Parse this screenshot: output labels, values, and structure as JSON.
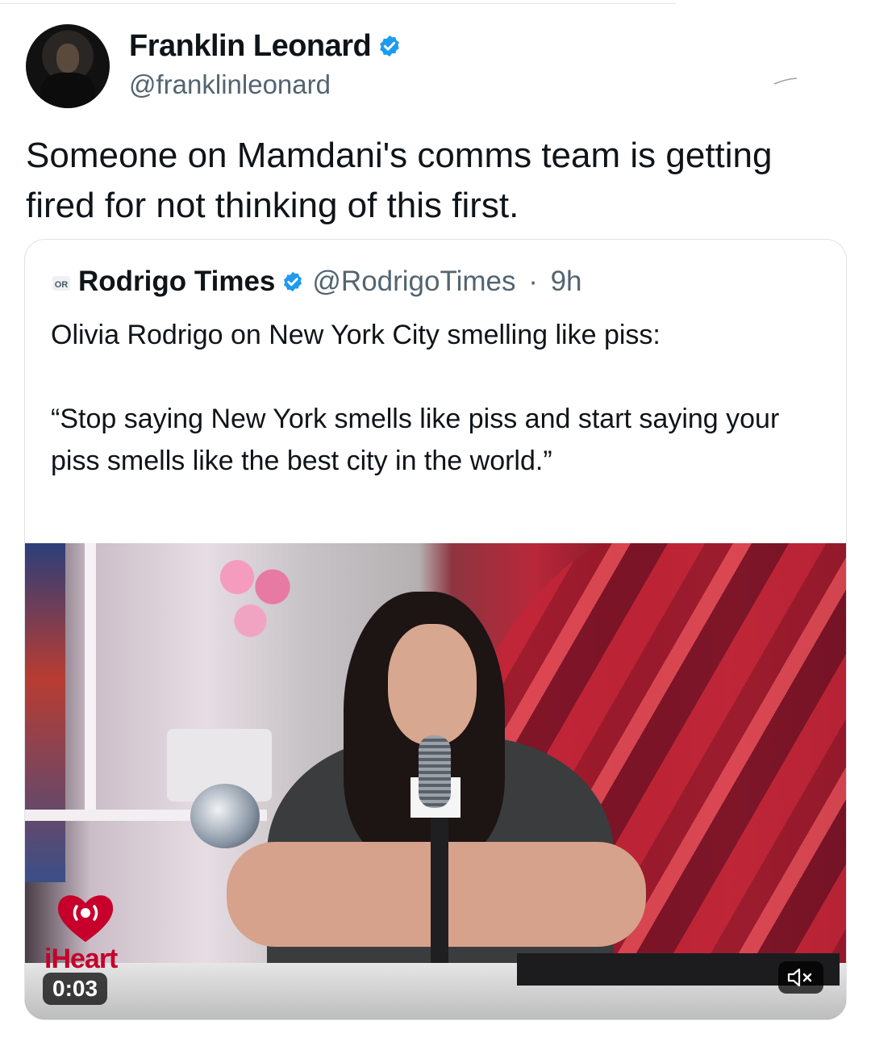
{
  "author": {
    "name": "Franklin Leonard",
    "handle": "@franklinleonard",
    "avatar_icon": "avatar-photo",
    "verified_color": "#1d9bf0"
  },
  "tweet": {
    "text": "Someone on Mamdani's comms team is getting fired for not thinking of this first."
  },
  "quoted_tweet": {
    "logo_text": "OR",
    "name": "Rodrigo Times",
    "handle": "@RodrigoTimes",
    "separator": "·",
    "time": "9h",
    "text_line1": "Olivia Rodrigo on New York City smelling like piss:",
    "text_quote": "“Stop saying New York smells like piss and start saying your piss smells like the best city in the world.”",
    "media": {
      "brand": "iHeart",
      "timestamp": "0:03",
      "mute_icon": "speaker-muted-icon"
    }
  }
}
